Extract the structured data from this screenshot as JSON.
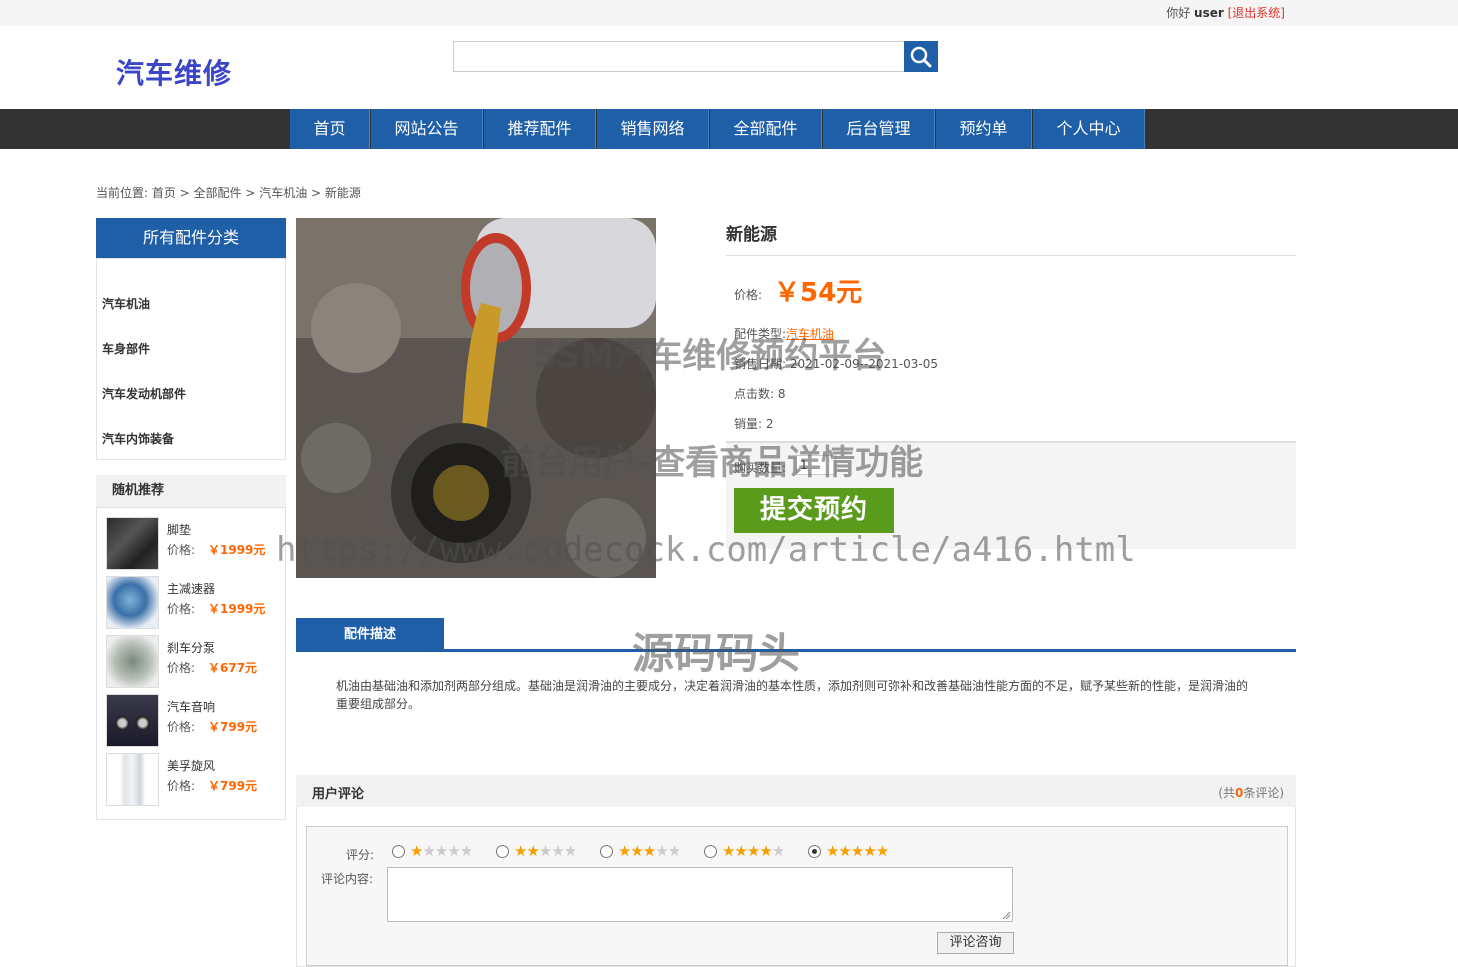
{
  "topbar": {
    "greeting": "你好 ",
    "username": "user",
    "logout": "[退出系统]"
  },
  "logo": "汽车维修",
  "search": {
    "placeholder": ""
  },
  "nav": [
    "首页",
    "网站公告",
    "推荐配件",
    "销售网络",
    "全部配件",
    "后台管理",
    "预约单",
    "个人中心"
  ],
  "breadcrumb": "当前位置: 首页 > 全部配件 > 汽车机油 > 新能源",
  "sidebar": {
    "category_title": "所有配件分类",
    "categories": [
      "汽车机油",
      "车身部件",
      "汽车发动机部件",
      "汽车内饰装备"
    ],
    "recommend_title": "随机推荐",
    "price_label": "价格:",
    "recommend": [
      {
        "name": "脚垫",
        "price": "￥1999元"
      },
      {
        "name": "主减速器",
        "price": "￥1999元"
      },
      {
        "name": "刹车分泵",
        "price": "￥677元"
      },
      {
        "name": "汽车音响",
        "price": "￥799元"
      },
      {
        "name": "美孚旋风",
        "price": "￥799元"
      }
    ]
  },
  "product": {
    "title": "新能源",
    "price_label": "价格:",
    "price": "￥54元",
    "type_label": "配件类型:",
    "type_value": "汽车机油",
    "date_label": "销售日期:",
    "date_value": "2021-02-09--2021-03-05",
    "clicks_label": "点击数:",
    "clicks_value": "8",
    "sales_label": "销量:",
    "sales_value": "2",
    "qty_label": "购买数量:",
    "qty_value": "1",
    "submit": "提交预约"
  },
  "description": {
    "tab": "配件描述",
    "text": "机油由基础油和添加剂两部分组成。基础油是润滑油的主要成分，决定着润滑油的基本性质，添加剂则可弥补和改善基础油性能方面的不足，赋予某些新的性能，是润滑油的重要组成部分。"
  },
  "reviews": {
    "title": "用户评论",
    "count_prefix": "(共",
    "count": "0",
    "count_suffix": "条评论)",
    "rate_label": "评分:",
    "ratings": [
      1,
      2,
      3,
      4,
      5
    ],
    "selected_rating": 5,
    "content_label": "评论内容:",
    "submit": "评论咨询"
  },
  "watermarks": {
    "line1": "SSM汽车维修预约平台",
    "line2": "前台用户-查看商品详情功能",
    "line3": "https://www.codecock.com/article/a416.html",
    "line4": "源码码头"
  },
  "colors": {
    "brand_blue": "#1e5fa8",
    "price_orange": "#ff6600",
    "submit_green": "#5a9b1c",
    "nav_dark": "#333333"
  }
}
